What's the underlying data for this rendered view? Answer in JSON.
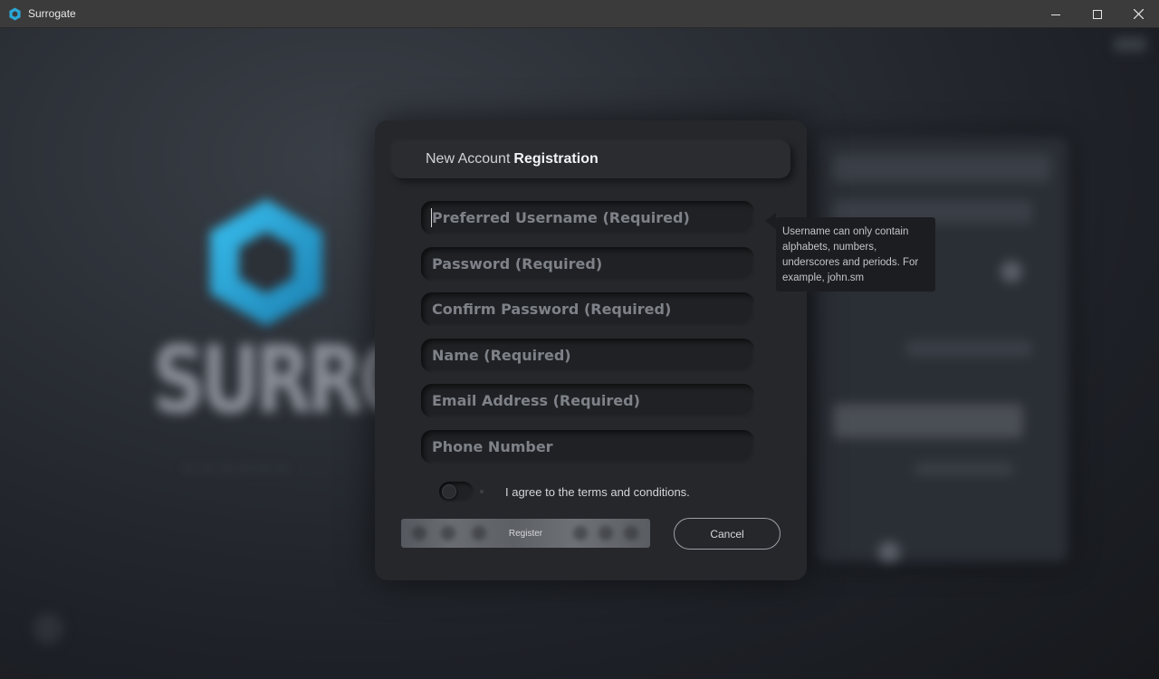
{
  "window": {
    "title": "Surrogate",
    "controls": [
      "minimize-icon",
      "maximize-icon",
      "close-icon"
    ],
    "icon": "surrogate-hexagon-icon"
  },
  "background": {
    "logo_word": "SURROGATE",
    "accent_color": "#2aa7d8"
  },
  "dialog": {
    "title_normal": "New Account",
    "title_bold": "Registration",
    "fields": [
      {
        "placeholder": "Preferred Username (Required)",
        "value": "",
        "type": "text"
      },
      {
        "placeholder": "Password (Required)",
        "value": "",
        "type": "password"
      },
      {
        "placeholder": "Confirm Password (Required)",
        "value": "",
        "type": "password"
      },
      {
        "placeholder": "Name (Required)",
        "value": "",
        "type": "text"
      },
      {
        "placeholder": "Email Address (Required)",
        "value": "",
        "type": "email"
      },
      {
        "placeholder": "Phone Number",
        "value": "",
        "type": "tel"
      }
    ],
    "tooltip": "Username can only contain alphabets, numbers, underscores and periods. For example, john.sm",
    "agree_label": "I agree to the terms and conditions.",
    "agree_checked": false,
    "register_label": "Register",
    "cancel_label": "Cancel"
  }
}
